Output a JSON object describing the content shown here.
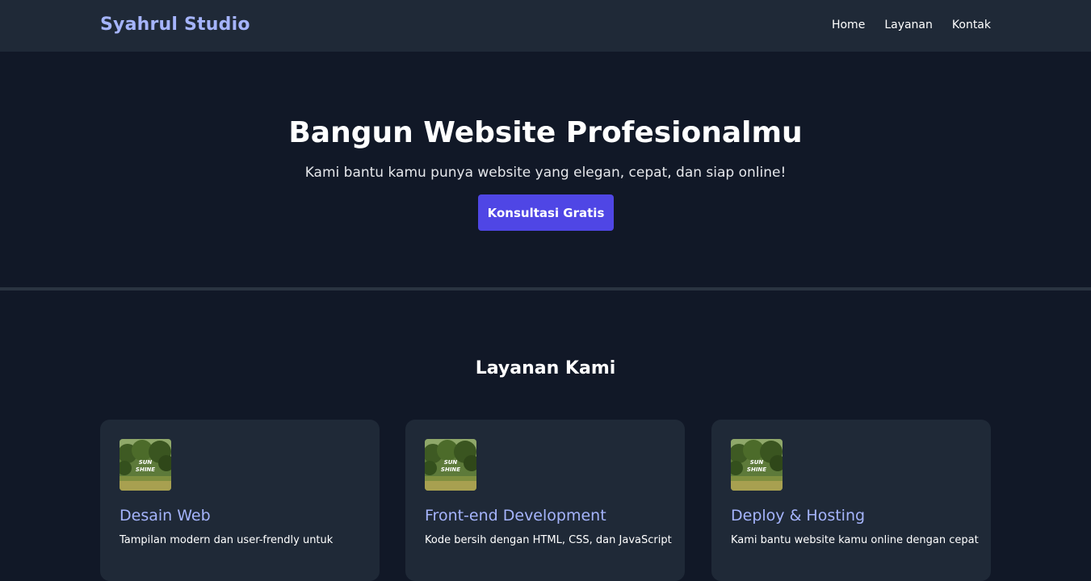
{
  "nav": {
    "brand": "Syahrul Studio",
    "links": [
      "Home",
      "Layanan",
      "Kontak"
    ]
  },
  "hero": {
    "title": "Bangun Website Profesionalmu",
    "subtitle": "Kami bantu kamu punya website yang elegan, cepat, dan siap online!",
    "cta_label": "Konsultasi Gratis"
  },
  "services": {
    "title": "Layanan Kami",
    "thumb_text": "SUN SHINE",
    "cards": [
      {
        "title": "Desain Web",
        "description": "Tampilan modern dan user-frendly untuk"
      },
      {
        "title": "Front-end Development",
        "description": "Kode bersih dengan HTML, CSS, dan JavaScript"
      },
      {
        "title": "Deploy & Hosting",
        "description": "Kami bantu website kamu online dengan cepat"
      }
    ]
  },
  "colors": {
    "page_bg": "#111827",
    "navbar_bg": "#1f2937",
    "accent": "#4f46e5",
    "brand_text": "#a5b4fc",
    "card_bg": "#1f2937"
  }
}
